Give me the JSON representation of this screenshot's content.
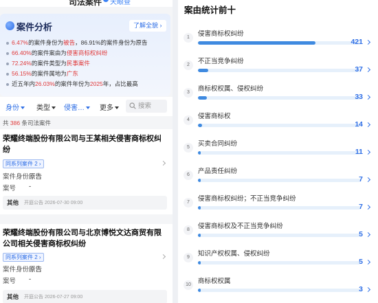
{
  "header": {
    "title": "司法案件",
    "badge": "天眼查"
  },
  "analysis": {
    "title": "案件分析",
    "more_label": "了解全貌",
    "stats": [
      {
        "pre": "",
        "hl": "6.47%",
        "mid": "的案件身份为",
        "hl2": "被告",
        "post": "，86.91%的案件身份为原告"
      },
      {
        "pre": "",
        "hl": "66.40%",
        "mid": "的案件案由为",
        "hl2": "侵害商标权纠纷",
        "post": ""
      },
      {
        "pre": "",
        "hl": "72.24%",
        "mid": "的案件类型为",
        "hl2": "民事案件",
        "post": ""
      },
      {
        "pre": "",
        "hl": "56.15%",
        "mid": "的案件属地为",
        "hl2": "广东",
        "post": ""
      },
      {
        "pre": "近五年内",
        "hl": "26.03%",
        "mid": "的案件年份为",
        "hl2": "2025",
        "post": "年，占比最高"
      }
    ]
  },
  "filters": {
    "items": [
      "身份",
      "类型",
      "侵害…",
      "更多"
    ],
    "search_placeholder": "搜索"
  },
  "count": {
    "pre": "共",
    "num": "386",
    "post": "条司法案件"
  },
  "cases": [
    {
      "title": "荣耀终端股份有限公司与王某相关侵害商标权纠纷",
      "series": "同系列案件 2",
      "role_label": "案件身份",
      "role_value": "原告",
      "case_no_label": "案号",
      "case_no_value": "-",
      "foot_type": "其他",
      "foot_info": "开庭公告 2026-07-30 09:00"
    },
    {
      "title": "荣耀终端股份有限公司与北京博悦文达商贸有限公司相关侵害商标权纠纷",
      "series": "同系列案件 2",
      "role_label": "案件身份",
      "role_value": "原告",
      "case_no_label": "案号",
      "case_no_value": "-",
      "foot_type": "其他",
      "foot_info": "开庭公告 2026-07-27 09:00"
    }
  ],
  "ranking": {
    "title": "案由统计前十",
    "accent": "#2f6fe6",
    "items": [
      {
        "rank": "1",
        "label": "侵害商标权纠纷",
        "value": "421"
      },
      {
        "rank": "2",
        "label": "不正当竞争纠纷",
        "value": "37"
      },
      {
        "rank": "3",
        "label": "商标权权属、侵权纠纷",
        "value": "33"
      },
      {
        "rank": "4",
        "label": "侵害商标权",
        "value": "14"
      },
      {
        "rank": "5",
        "label": "买卖合同纠纷",
        "value": "11"
      },
      {
        "rank": "6",
        "label": "产品责任纠纷",
        "value": "7"
      },
      {
        "rank": "7",
        "label": "侵害商标权纠纷；不正当竞争纠纷",
        "value": "7"
      },
      {
        "rank": "8",
        "label": "侵害商标权及不正当竞争纠纷",
        "value": "5"
      },
      {
        "rank": "9",
        "label": "知识产权权属、侵权纠纷",
        "value": "5"
      },
      {
        "rank": "10",
        "label": "商标权权属",
        "value": "3"
      }
    ]
  }
}
